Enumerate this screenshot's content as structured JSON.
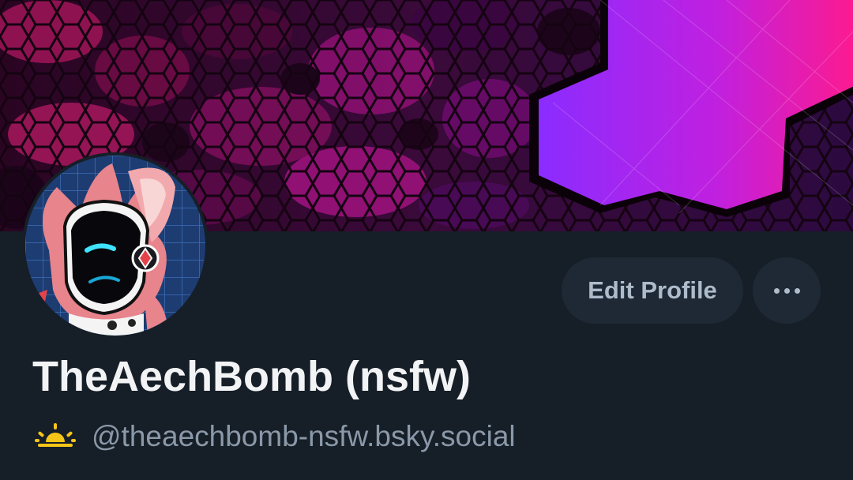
{
  "profile": {
    "display_name": "TheAechBomb (nsfw)",
    "handle": "@theaechbomb-nsfw.bsky.social"
  },
  "actions": {
    "edit_profile_label": "Edit Profile"
  },
  "icons": {
    "more_options": "ellipsis-icon",
    "handle_badge": "sunrise-icon"
  },
  "colors": {
    "background": "#161e27",
    "button_bg": "#1e2935",
    "button_text": "#aebbca",
    "name_text": "#f1f3f5",
    "handle_text": "#8a98a8",
    "banner_accent_magenta": "#ff1a8c",
    "banner_accent_purple": "#8a2cff",
    "badge_yellow": "#f5c518"
  }
}
